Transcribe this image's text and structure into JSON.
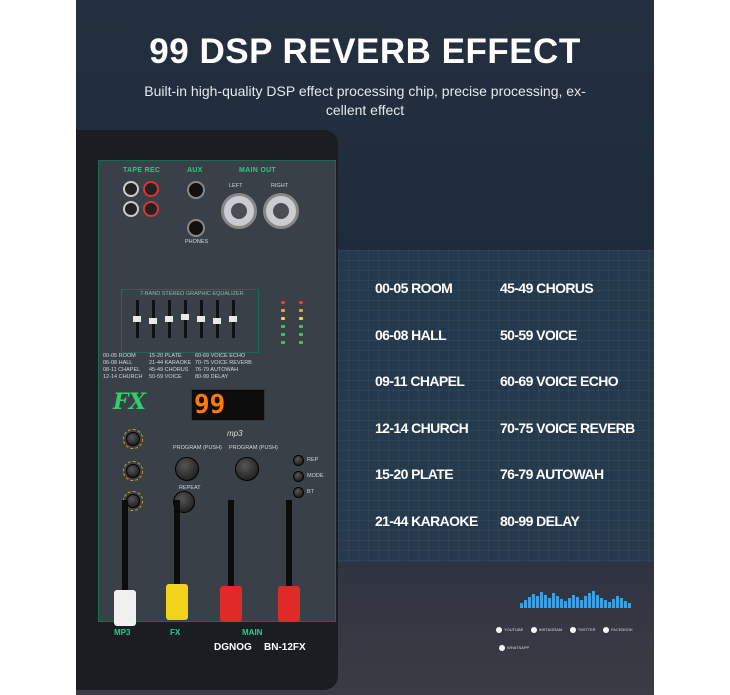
{
  "headline": "99 DSP REVERB EFFECT",
  "subtitle": "Built-in high-quality DSP effect processing chip, precise processing, ex-\ncellent effect",
  "mixer": {
    "sections": {
      "tape_rec": "TAPE REC",
      "aux": "AUX",
      "main_out": "MAIN OUT",
      "left": "LEFT",
      "right": "RIGHT",
      "phones": "PHONES",
      "eq_title": "7-BAND STEREO GRAPHIC EQUALIZER",
      "fx_logo": "FX",
      "display": "99",
      "mp3": "mp3",
      "program_push": "PROGRAM (PUSH)",
      "repeat": "REPEAT",
      "rep": "REP",
      "mode": "MODE",
      "bt": "BT"
    },
    "preset_table": [
      "00-05 ROOM",
      "06-08 HALL",
      "08-11 CHAPEL",
      "12-14 CHURCH",
      "15-20 PLATE",
      "21-44 KARAOKE",
      "45-49 CHORUS",
      "50-59 VOICE",
      "60-69 VOICE ECHO",
      "70-75 VOICE REVERB",
      "76-79 AUTOWAH",
      "80-99 DELAY"
    ],
    "faders": {
      "mp3": "MP3",
      "fx": "FX",
      "main": "MAIN"
    },
    "brand": "DGNOG",
    "model": "BN-12FX"
  },
  "effects": {
    "left": [
      "00-05 ROOM",
      "06-08 HALL",
      "09-11 CHAPEL",
      "12-14 CHURCH",
      "15-20 PLATE",
      "21-44 KARAOKE"
    ],
    "right": [
      "45-49 CHORUS",
      "50-59 VOICE",
      "60-69 VOICE ECHO",
      "70-75 VOICE REVERB",
      "76-79 AUTOWAH",
      "80-99 DELAY"
    ]
  },
  "social": [
    "YOUTUBE",
    "INSTAGRAM",
    "TWITTER",
    "FACEBOOK",
    "WHATSAPP"
  ],
  "colors": {
    "accent_green": "#1fd08c",
    "display_orange": "#ff7a00",
    "eq_cap": "#e8e8e8",
    "cap_white": "#f0f0f0",
    "cap_yellow": "#f2d21a",
    "cap_red": "#e02a2a",
    "viz_blue": "#3aa0e0"
  }
}
